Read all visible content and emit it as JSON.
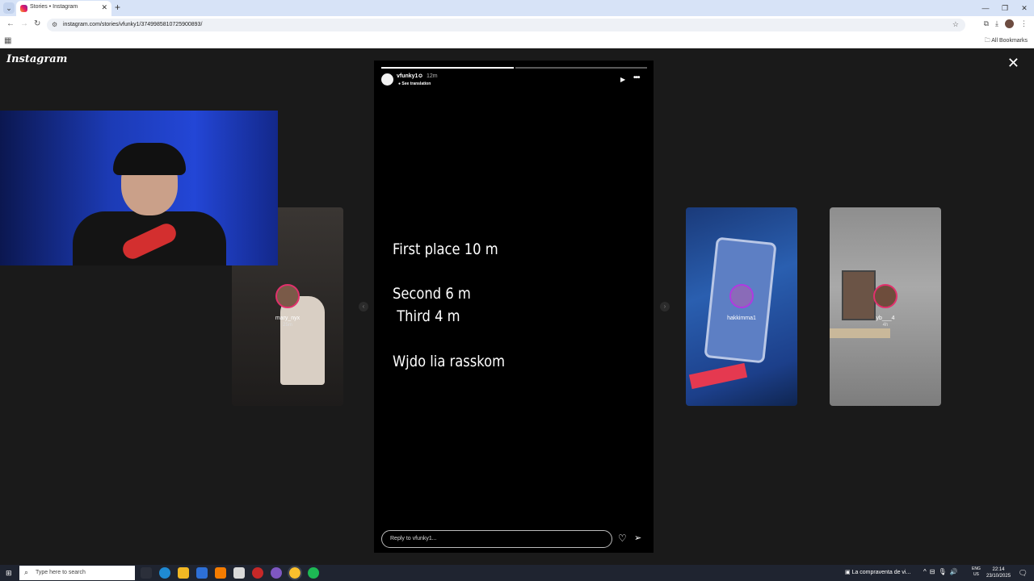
{
  "browser": {
    "tab_title": "Stories • Instagram",
    "tab_close": "✕",
    "new_tab": "+",
    "url": "instagram.com/stories/vfunky1/3749985810725900893/",
    "all_bookmarks": "All Bookmarks"
  },
  "page": {
    "logo": "Instagram",
    "close_glyph": "✕"
  },
  "side_stories": [
    {
      "username": "mary_nyx",
      "time": "25m"
    },
    {
      "username": "hakkimma1",
      "time": ""
    },
    {
      "username": "yb___4",
      "time": "4h"
    }
  ],
  "story": {
    "progress_total": 2,
    "progress_done": 1,
    "username": "vfunky1",
    "time": "12m",
    "see_translation": "See translation",
    "text_lines": [
      "First place 10 m",
      "Second 6 m",
      " Third 4 m",
      "Wjdo lia rasskom"
    ],
    "reply_placeholder": "Reply to vfunky1..."
  },
  "taskbar": {
    "search_placeholder": "Type here to search",
    "news": "La compraventa de vi...",
    "lang_1": "ENG",
    "lang_2": "US",
    "time": "22:14",
    "date": "23/10/2025"
  },
  "colors": {
    "accent": "#e1306c",
    "background": "#1a1a1a"
  }
}
